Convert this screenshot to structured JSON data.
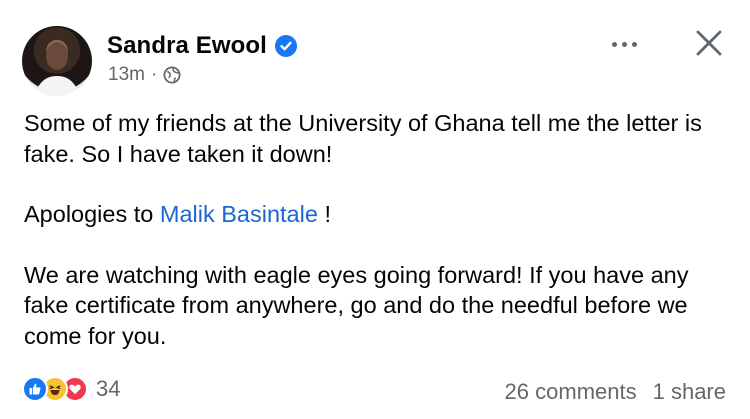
{
  "post": {
    "author": "Sandra Ewool",
    "time": "13m",
    "separator": "·",
    "privacy_icon": "globe-icon",
    "paragraph1": "Some of my friends at the University of Ghana tell me the letter is fake. So I have taken it down!",
    "apology_prefix": "Apologies to",
    "mention": "Malik Basintale",
    "apology_suffix": "!",
    "paragraph3": "We are watching with eagle eyes going forward! If you have any fake certificate from anywhere, go and do the needful before we come for you."
  },
  "footer": {
    "reaction_icons": [
      "like-icon",
      "haha-icon",
      "love-icon"
    ],
    "reaction_count": "34",
    "comments": "26 comments",
    "shares": "1 share"
  },
  "colors": {
    "mention": "#1b66d1",
    "muted": "#65676b",
    "verified": "#1877f2"
  }
}
